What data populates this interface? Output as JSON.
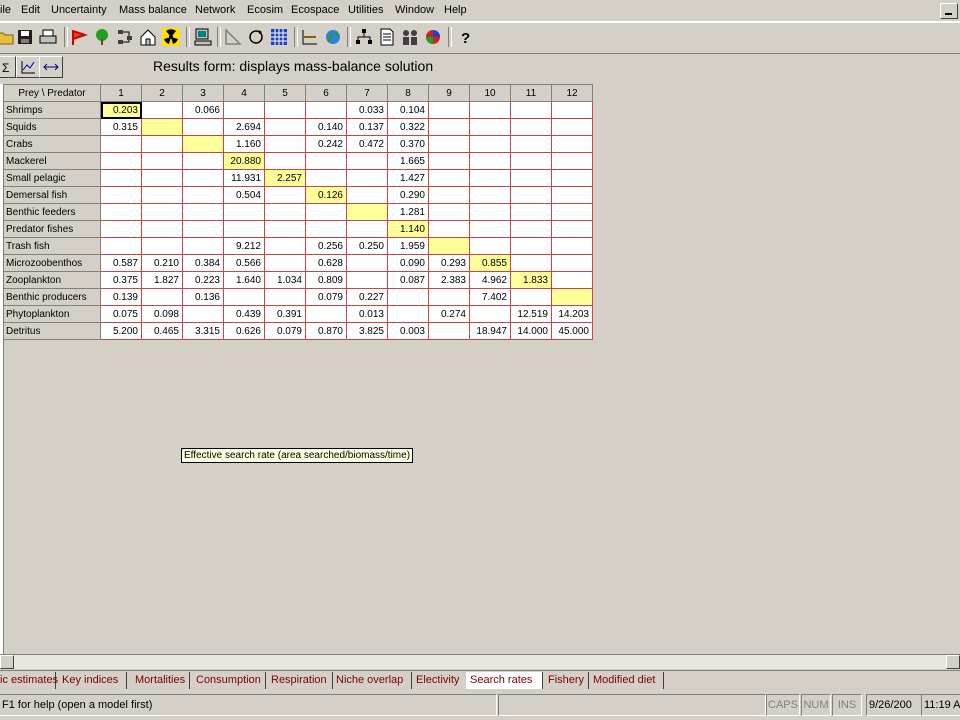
{
  "menu": {
    "items": [
      "ile",
      "Edit",
      "Uncertainty",
      "Mass balance",
      "Network",
      "Ecosim",
      "Ecospace",
      "Utilities",
      "Window",
      "Help"
    ]
  },
  "toolbar": {
    "icons": [
      "open-folder-icon",
      "save-disk-icon",
      "print-icon",
      "red-flag-icon",
      "tree-icon",
      "network-graph-icon",
      "house-icon",
      "radiation-icon",
      "computer-icon",
      "triangle-ruler-icon",
      "cycle-icon",
      "grid-icon",
      "axes-icon",
      "globe-icon",
      "hierarchy-icon",
      "document-icon",
      "family-icon",
      "color-ball-icon",
      "help-icon"
    ]
  },
  "results": {
    "title": "Results form: displays mass-balance solution"
  },
  "grid": {
    "corner": "Prey \\ Predator",
    "columns": [
      "1",
      "2",
      "3",
      "4",
      "5",
      "6",
      "7",
      "8",
      "9",
      "10",
      "11",
      "12"
    ],
    "rows": [
      {
        "label": "Shrimps",
        "values": [
          "0.203",
          "",
          "0.066",
          "",
          "",
          "",
          "0.033",
          "0.104",
          "",
          "",
          "",
          ""
        ]
      },
      {
        "label": "Squids",
        "values": [
          "0.315",
          "",
          "",
          "2.694",
          "",
          "0.140",
          "0.137",
          "0.322",
          "",
          "",
          "",
          ""
        ]
      },
      {
        "label": "Crabs",
        "values": [
          "",
          "",
          "",
          "1.160",
          "",
          "0.242",
          "0.472",
          "0.370",
          "",
          "",
          "",
          ""
        ]
      },
      {
        "label": "Mackerel",
        "values": [
          "",
          "",
          "",
          "20.880",
          "",
          "",
          "",
          "1.665",
          "",
          "",
          "",
          ""
        ]
      },
      {
        "label": "Small pelagic",
        "values": [
          "",
          "",
          "",
          "11.931",
          "2.257",
          "",
          "",
          "1.427",
          "",
          "",
          "",
          ""
        ]
      },
      {
        "label": "Demersal fish",
        "values": [
          "",
          "",
          "",
          "0.504",
          "",
          "0.126",
          "",
          "0.290",
          "",
          "",
          "",
          ""
        ]
      },
      {
        "label": "Benthic feeders",
        "values": [
          "",
          "",
          "",
          "",
          "",
          "",
          "",
          "1.281",
          "",
          "",
          "",
          ""
        ]
      },
      {
        "label": "Predator fishes",
        "values": [
          "",
          "",
          "",
          "",
          "",
          "",
          "",
          "1.140",
          "",
          "",
          "",
          ""
        ]
      },
      {
        "label": "Trash fish",
        "values": [
          "",
          "",
          "",
          "9.212",
          "",
          "0.256",
          "0.250",
          "1.959",
          "",
          "",
          "",
          ""
        ]
      },
      {
        "label": "Microzoobenthos",
        "values": [
          "0.587",
          "0.210",
          "0.384",
          "0.566",
          "",
          "0.628",
          "",
          "0.090",
          "0.293",
          "0.855",
          "",
          ""
        ]
      },
      {
        "label": "Zooplankton",
        "values": [
          "0.375",
          "1.827",
          "0.223",
          "1.640",
          "1.034",
          "0.809",
          "",
          "0.087",
          "2.383",
          "4.962",
          "1.833",
          ""
        ]
      },
      {
        "label": "Benthic producers",
        "values": [
          "0.139",
          "",
          "0.136",
          "",
          "",
          "0.079",
          "0.227",
          "",
          "",
          "7.402",
          "",
          ""
        ]
      },
      {
        "label": "Phytoplankton",
        "values": [
          "0.075",
          "0.098",
          "",
          "0.439",
          "0.391",
          "",
          "0.013",
          "",
          "0.274",
          "",
          "12.519",
          "14.203"
        ]
      },
      {
        "label": "Detritus",
        "values": [
          "5.200",
          "0.465",
          "3.315",
          "0.626",
          "0.079",
          "0.870",
          "3.825",
          "0.003",
          "",
          "18.947",
          "14.000",
          "45.000"
        ]
      }
    ]
  },
  "tooltip": "Effective search rate (area searched/biomass/time)",
  "tabs": [
    "ic estimates",
    "Key indices",
    "Mortalities",
    "Consumption",
    "Respiration",
    "Niche overlap",
    "Electivity",
    "Search rates",
    "Fishery",
    "Modified diet"
  ],
  "active_tab": "Search rates",
  "status": {
    "help": "F1 for help (open a model first)",
    "caps": "CAPS",
    "num": "NUM",
    "ins": "INS",
    "date": "9/26/200",
    "time": "11:19 A"
  },
  "colors": {
    "diagonal_highlight": "#ffff99",
    "grid_lines": "#cc4444",
    "tab_text": "#800000"
  }
}
